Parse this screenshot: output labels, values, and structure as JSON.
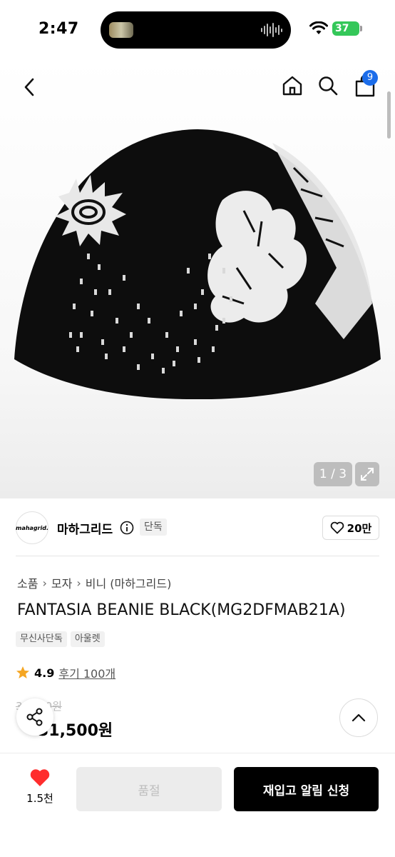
{
  "status_bar": {
    "time": "2:47",
    "battery": "37"
  },
  "header": {
    "cart_count": "9"
  },
  "gallery": {
    "pager": "1 / 3"
  },
  "brand": {
    "logo_text": "mahagrid.",
    "name": "마하그리드",
    "tag": "단독",
    "likes": "20만"
  },
  "breadcrumb": [
    "소품",
    "모자",
    "비니 (마하그리드)"
  ],
  "product": {
    "title": "FANTASIA BEANIE BLACK(MG2DFMAB21A)",
    "tags": [
      "무신사단독",
      "아울렛"
    ],
    "rating": "4.9",
    "reviews": "후기 100개",
    "price_original": "3_ _ _0원",
    "price_now": "31,500원"
  },
  "bottom_bar": {
    "wish_count": "1.5천",
    "soldout_label": "품절",
    "restock_label": "재입고 알림 신청"
  },
  "colors": {
    "accent_blue": "#1c6dea",
    "heart_red": "#ff2d2d",
    "battery_green": "#34c759"
  }
}
